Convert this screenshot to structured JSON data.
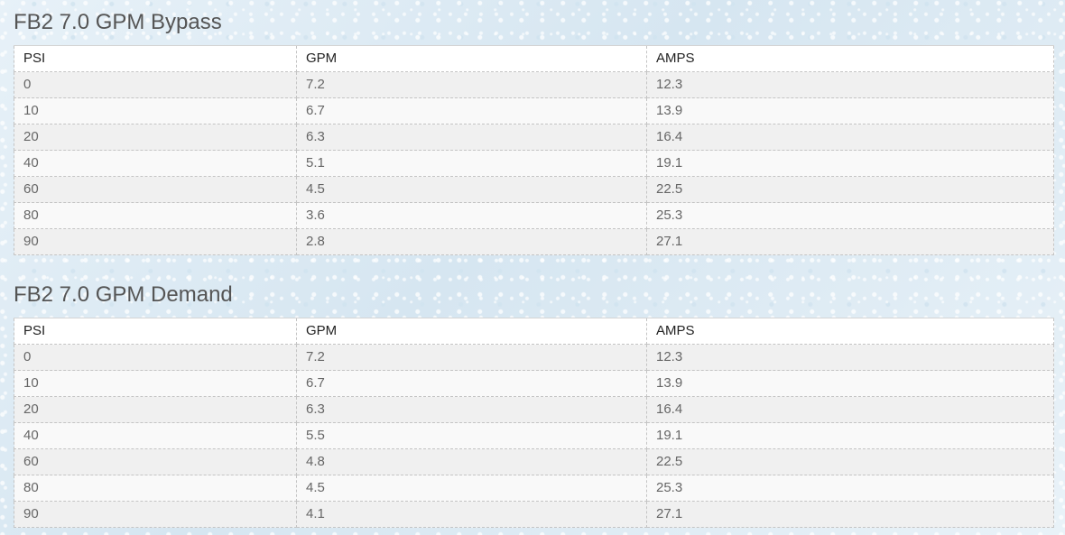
{
  "tables": [
    {
      "title": "FB2 7.0 GPM Bypass",
      "headers": [
        "PSI",
        "GPM",
        "AMPS"
      ],
      "rows": [
        [
          "0",
          "7.2",
          "12.3"
        ],
        [
          "10",
          "6.7",
          "13.9"
        ],
        [
          "20",
          "6.3",
          "16.4"
        ],
        [
          "40",
          "5.1",
          "19.1"
        ],
        [
          "60",
          "4.5",
          "22.5"
        ],
        [
          "80",
          "3.6",
          "25.3"
        ],
        [
          "90",
          "2.8",
          "27.1"
        ]
      ]
    },
    {
      "title": "FB2 7.0 GPM Demand",
      "headers": [
        "PSI",
        "GPM",
        "AMPS"
      ],
      "rows": [
        [
          "0",
          "7.2",
          "12.3"
        ],
        [
          "10",
          "6.7",
          "13.9"
        ],
        [
          "20",
          "6.3",
          "16.4"
        ],
        [
          "40",
          "5.5",
          "19.1"
        ],
        [
          "60",
          "4.8",
          "22.5"
        ],
        [
          "80",
          "4.5",
          "25.3"
        ],
        [
          "90",
          "4.1",
          "27.1"
        ]
      ]
    }
  ],
  "colors": {
    "title": "#555555",
    "header_text": "#222222",
    "cell_text": "#666666",
    "row_odd": "#f0f0f0",
    "row_even": "#f9f9f9",
    "border": "#c4c4c4"
  }
}
